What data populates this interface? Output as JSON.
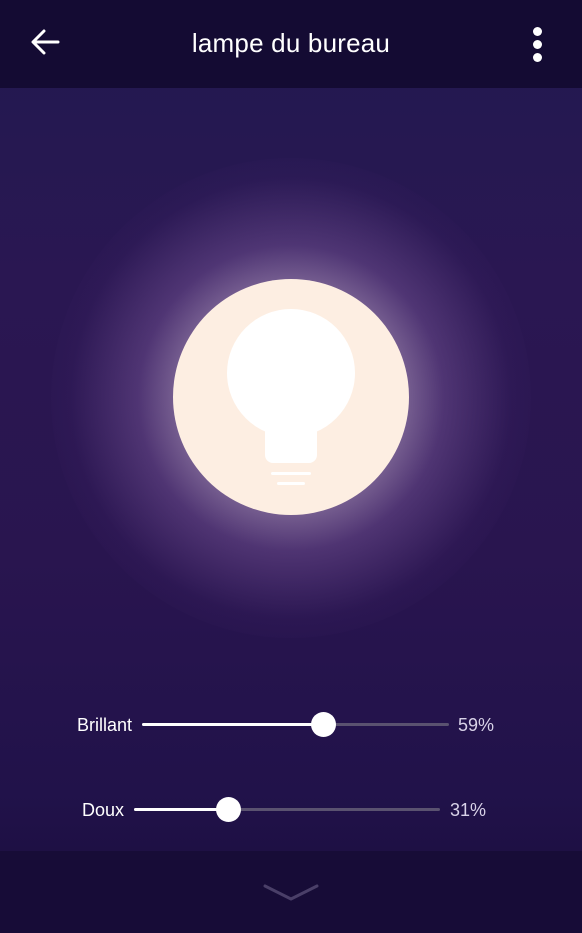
{
  "header": {
    "title": "lampe du bureau",
    "back_icon": "arrow-left-icon",
    "menu_icon": "more-vertical-icon"
  },
  "light": {
    "icon": "lightbulb-icon",
    "glow_color": "#fdeee2"
  },
  "sliders": [
    {
      "label": "Brillant",
      "value_text": "59%",
      "value": 0.59
    },
    {
      "label": "Doux",
      "value_text": "31%",
      "value": 0.31
    }
  ],
  "footer": {
    "expand_icon": "chevron-down-icon"
  },
  "colors": {
    "topbar": "#140b33",
    "background": "#29154f",
    "track": "#5a5270",
    "fill": "#ffffff"
  }
}
